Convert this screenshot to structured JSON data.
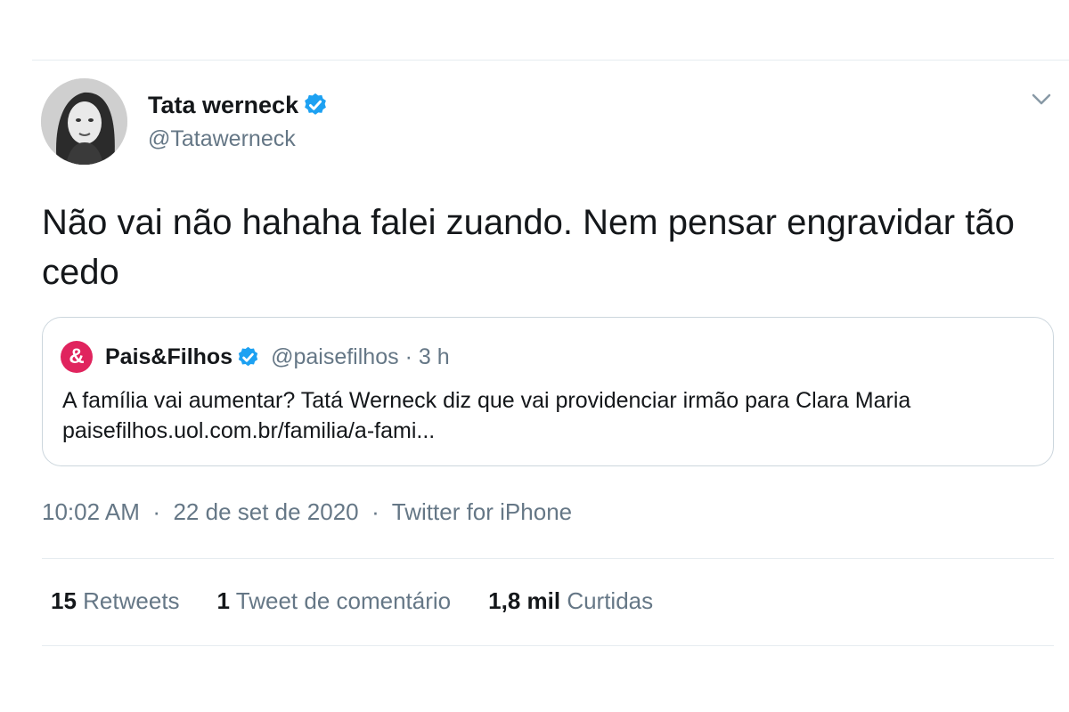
{
  "tweet": {
    "author": {
      "display_name": "Tata werneck",
      "username": "@Tatawerneck",
      "verified": true
    },
    "text": "Não vai não hahaha falei zuando. Nem pensar engravidar tão cedo",
    "quoted": {
      "avatar_glyph": "&",
      "display_name": "Pais&Filhos",
      "username": "@paisefilhos",
      "separator": "·",
      "time_ago": "3 h",
      "text": "A família vai aumentar? Tatá Werneck diz que vai providenciar irmão para Clara Maria paisefilhos.uol.com.br/familia/a-fami..."
    },
    "time": "10:02 AM",
    "date": "22 de set de 2020",
    "source": "Twitter for iPhone",
    "separator": "·",
    "stats": [
      {
        "count": "15",
        "label": "Retweets"
      },
      {
        "count": "1",
        "label": "Tweet de comentário"
      },
      {
        "count": "1,8 mil",
        "label": "Curtidas"
      }
    ]
  },
  "icons": {
    "verified": "verified-badge-icon",
    "menu": "chevron-down-icon"
  },
  "colors": {
    "verified_blue": "#1da1f2",
    "secondary_text": "#657786",
    "quote_brand": "#e0245e",
    "border": "#ccd6dd"
  }
}
